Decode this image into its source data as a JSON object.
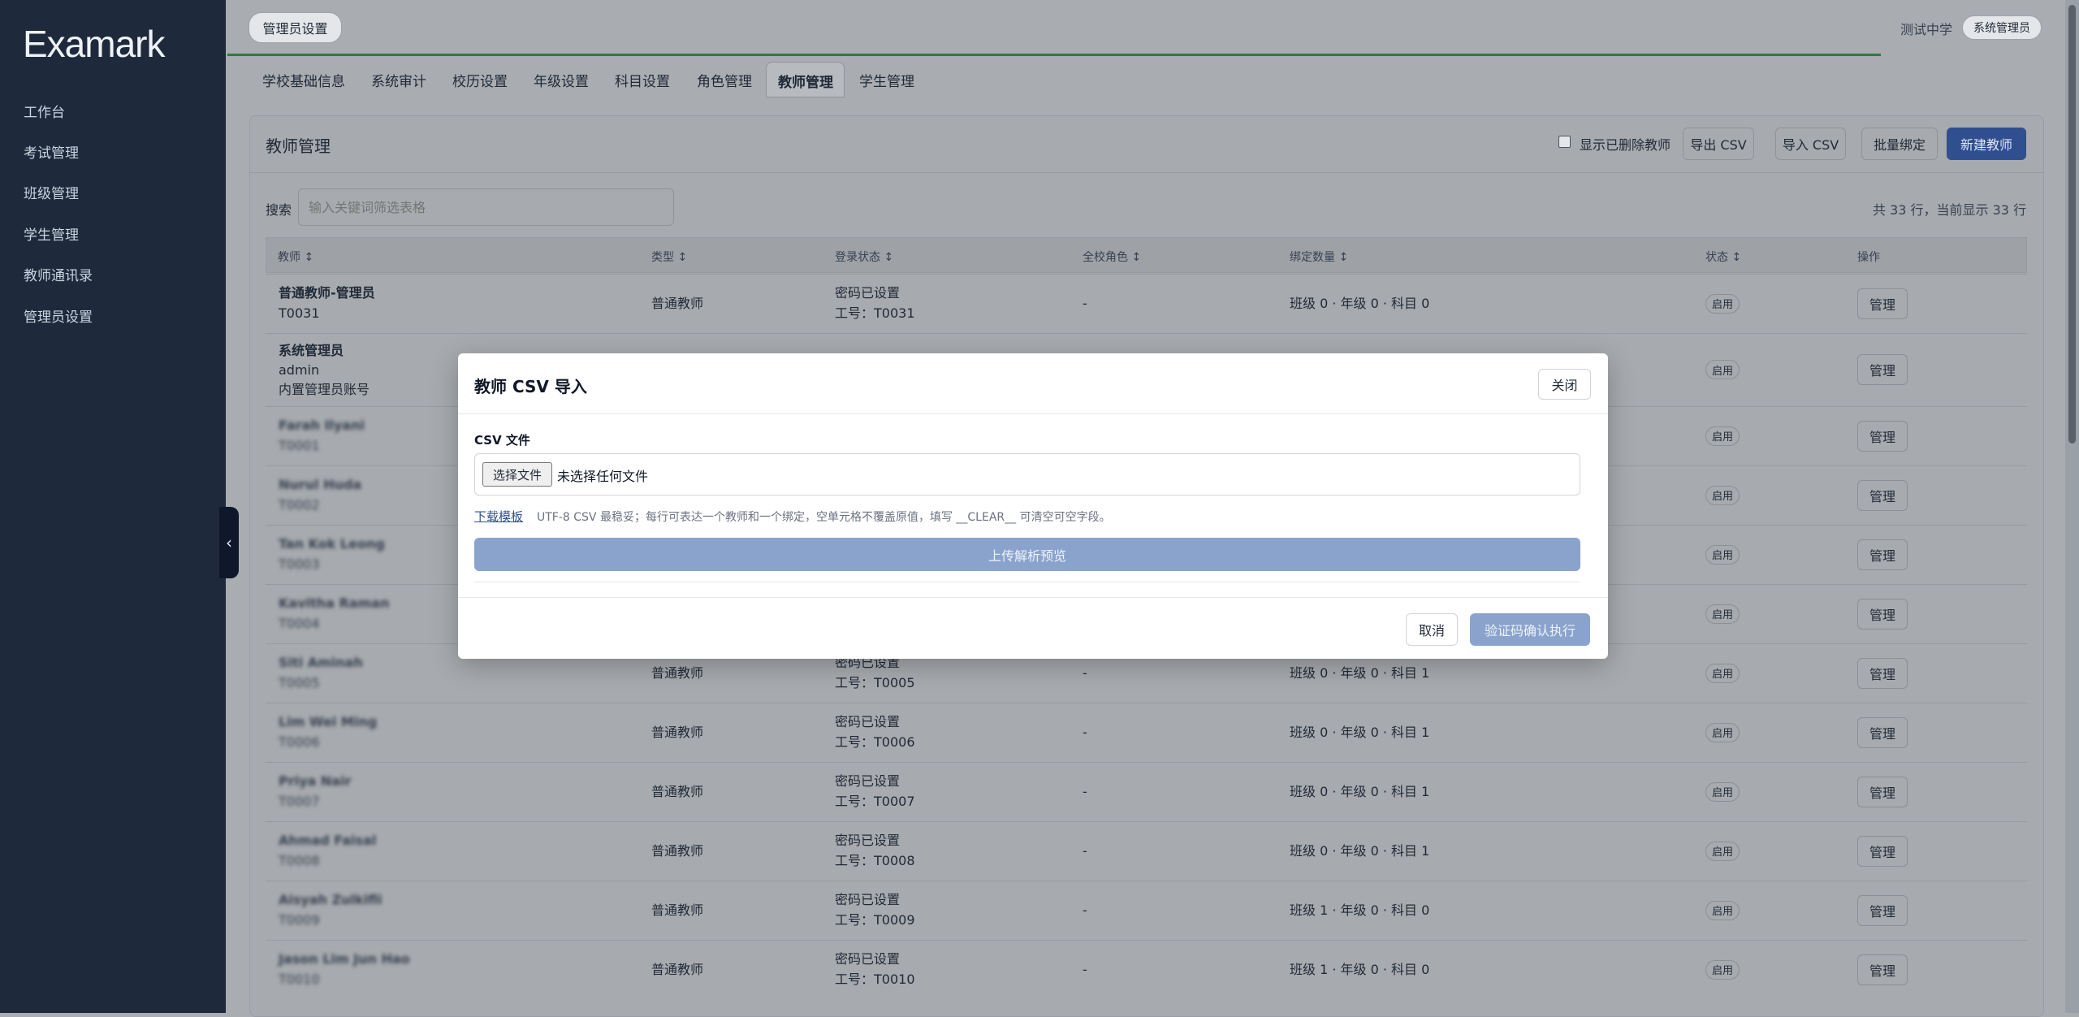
{
  "app": {
    "logo": "Examark"
  },
  "sidebar": {
    "items": [
      {
        "label": "工作台"
      },
      {
        "label": "考试管理"
      },
      {
        "label": "班级管理"
      },
      {
        "label": "学生管理"
      },
      {
        "label": "教师通讯录"
      },
      {
        "label": "管理员设置"
      }
    ]
  },
  "header": {
    "page_pill": "管理员设置",
    "school": "测试中学",
    "role": "系统管理员"
  },
  "tabs": [
    {
      "label": "学校基础信息"
    },
    {
      "label": "系统审计"
    },
    {
      "label": "校历设置"
    },
    {
      "label": "年级设置"
    },
    {
      "label": "科目设置"
    },
    {
      "label": "角色管理"
    },
    {
      "label": "教师管理"
    },
    {
      "label": "学生管理"
    }
  ],
  "panel": {
    "title": "教师管理",
    "show_deleted": "显示已删除教师",
    "export_csv": "导出 CSV",
    "import_csv": "导入 CSV",
    "bulk_bind": "批量绑定",
    "new_teacher": "新建教师",
    "search_label": "搜索",
    "search_placeholder": "输入关键词筛选表格",
    "count": "共 33 行，当前显示 33 行"
  },
  "table": {
    "headers": [
      "教师 ↕",
      "类型 ↕",
      "登录状态 ↕",
      "全校角色 ↕",
      "绑定数量 ↕",
      "状态 ↕",
      "操作"
    ],
    "rows": [
      {
        "name": "普通教师-管理员",
        "id": "T0031",
        "extra": "",
        "type": "普通教师",
        "login": "密码已设置",
        "emp": "工号：T0031",
        "role": "-",
        "binds": "班级 0 · 年级 0 · 科目 0",
        "status": "启用",
        "action": "管理"
      },
      {
        "name": "系统管理员",
        "id": "admin",
        "extra": "内置管理员账号",
        "type": "",
        "login": "",
        "emp": "",
        "role": "",
        "binds": "",
        "status": "启用",
        "action": "管理"
      },
      {
        "name": "Farah Ilyani",
        "id": "T0001",
        "extra": "",
        "type": "",
        "login": "",
        "emp": "",
        "role": "",
        "binds": "",
        "status": "启用",
        "action": "管理"
      },
      {
        "name": "Nurul Huda",
        "id": "T0002",
        "extra": "",
        "type": "",
        "login": "",
        "emp": "",
        "role": "",
        "binds": "",
        "status": "启用",
        "action": "管理"
      },
      {
        "name": "Tan Kok Leong",
        "id": "T0003",
        "extra": "",
        "type": "",
        "login": "",
        "emp": "",
        "role": "",
        "binds": "",
        "status": "启用",
        "action": "管理"
      },
      {
        "name": "Kavitha Raman",
        "id": "T0004",
        "extra": "",
        "type": "",
        "login": "",
        "emp": "",
        "role": "",
        "binds": "",
        "status": "启用",
        "action": "管理"
      },
      {
        "name": "Siti Aminah",
        "id": "T0005",
        "extra": "",
        "type": "普通教师",
        "login": "密码已设置",
        "emp": "工号：T0005",
        "role": "-",
        "binds": "班级 0 · 年级 0 · 科目 1",
        "status": "启用",
        "action": "管理"
      },
      {
        "name": "Lim Wei Ming",
        "id": "T0006",
        "extra": "",
        "type": "普通教师",
        "login": "密码已设置",
        "emp": "工号：T0006",
        "role": "-",
        "binds": "班级 0 · 年级 0 · 科目 1",
        "status": "启用",
        "action": "管理"
      },
      {
        "name": "Priya Nair",
        "id": "T0007",
        "extra": "",
        "type": "普通教师",
        "login": "密码已设置",
        "emp": "工号：T0007",
        "role": "-",
        "binds": "班级 0 · 年级 0 · 科目 1",
        "status": "启用",
        "action": "管理"
      },
      {
        "name": "Ahmad Faisal",
        "id": "T0008",
        "extra": "",
        "type": "普通教师",
        "login": "密码已设置",
        "emp": "工号：T0008",
        "role": "-",
        "binds": "班级 0 · 年级 0 · 科目 1",
        "status": "启用",
        "action": "管理"
      },
      {
        "name": "Aisyah Zulkifli",
        "id": "T0009",
        "extra": "",
        "type": "普通教师",
        "login": "密码已设置",
        "emp": "工号：T0009",
        "role": "-",
        "binds": "班级 1 · 年级 0 · 科目 0",
        "status": "启用",
        "action": "管理"
      },
      {
        "name": "Jason Lim Jun Hao",
        "id": "T0010",
        "extra": "",
        "type": "普通教师",
        "login": "密码已设置",
        "emp": "工号：T0010",
        "role": "-",
        "binds": "班级 1 · 年级 0 · 科目 0",
        "status": "启用",
        "action": "管理"
      }
    ]
  },
  "modal": {
    "title": "教师 CSV 导入",
    "close": "关闭",
    "file_label": "CSV 文件",
    "choose_file": "选择文件",
    "no_file": "未选择任何文件",
    "download_template": "下载模板",
    "hint": "UTF-8 CSV 最稳妥；每行可表达一个教师和一个绑定，空单元格不覆盖原值，填写 __CLEAR__ 可清空可空字段。",
    "upload_preview": "上传解析预览",
    "cancel": "取消",
    "confirm": "验证码确认执行"
  },
  "colors": {
    "sidebar": "#1e293b",
    "primary": "#2f4f8f",
    "primary_disabled": "#8aa3cd",
    "green_accent": "#2f7a3c"
  }
}
